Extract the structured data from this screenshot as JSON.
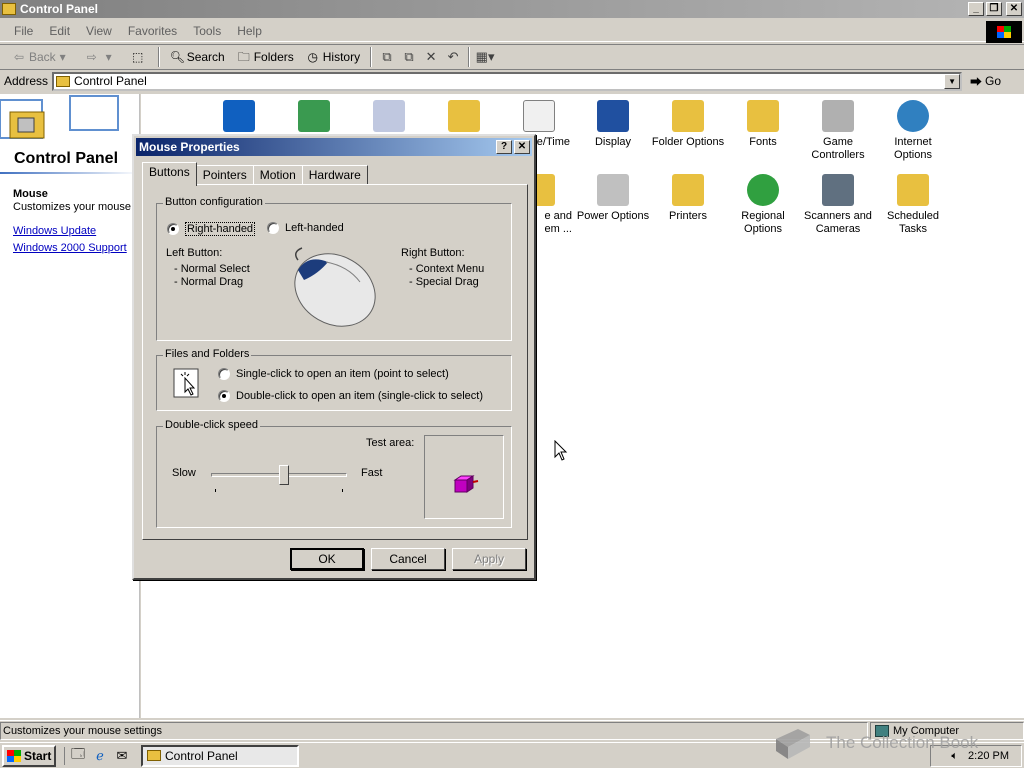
{
  "window": {
    "title": "Control Panel"
  },
  "menu": [
    "File",
    "Edit",
    "View",
    "Favorites",
    "Tools",
    "Help"
  ],
  "toolbar": {
    "back": "Back",
    "search": "Search",
    "folders": "Folders",
    "history": "History"
  },
  "address": {
    "label": "Address",
    "value": "Control Panel",
    "go": "Go"
  },
  "left_pane": {
    "title": "Control Panel",
    "selected_name": "Mouse",
    "selected_desc": "Customizes your mouse settings",
    "links": [
      "Windows Update",
      "Windows 2000 Support"
    ]
  },
  "icons": [
    {
      "label": "Display"
    },
    {
      "label": "Folder Options"
    },
    {
      "label": "Fonts"
    },
    {
      "label": "Game Controllers"
    },
    {
      "label": "Internet Options"
    },
    {
      "label": "Power Options"
    },
    {
      "label": "Printers"
    },
    {
      "label": "Regional Options"
    },
    {
      "label": "Scanners and Cameras"
    },
    {
      "label": "Scheduled Tasks"
    },
    {
      "label": "e/Time"
    },
    {
      "label": "e and"
    },
    {
      "label": "em ..."
    }
  ],
  "dialog": {
    "title": "Mouse Properties",
    "tabs": [
      "Buttons",
      "Pointers",
      "Motion",
      "Hardware"
    ],
    "button_config": {
      "legend": "Button configuration",
      "right_handed": "Right-handed",
      "left_handed": "Left-handed",
      "left_button_label": "Left Button:",
      "left_button_items": [
        "- Normal Select",
        "- Normal Drag"
      ],
      "right_button_label": "Right Button:",
      "right_button_items": [
        "- Context Menu",
        "- Special Drag"
      ]
    },
    "files_folders": {
      "legend": "Files and Folders",
      "single": "Single-click to open an item (point to select)",
      "double": "Double-click to open an item (single-click to select)"
    },
    "double_click": {
      "legend": "Double-click speed",
      "slow": "Slow",
      "fast": "Fast",
      "test_area": "Test area:",
      "level": 0.5
    },
    "buttons": {
      "ok": "OK",
      "cancel": "Cancel",
      "apply": "Apply"
    }
  },
  "statusbar": {
    "text": "Customizes your mouse settings",
    "zone": "My Computer"
  },
  "taskbar": {
    "start": "Start",
    "task": "Control Panel",
    "time": "2:20 PM"
  },
  "watermark": "The Collection Book"
}
